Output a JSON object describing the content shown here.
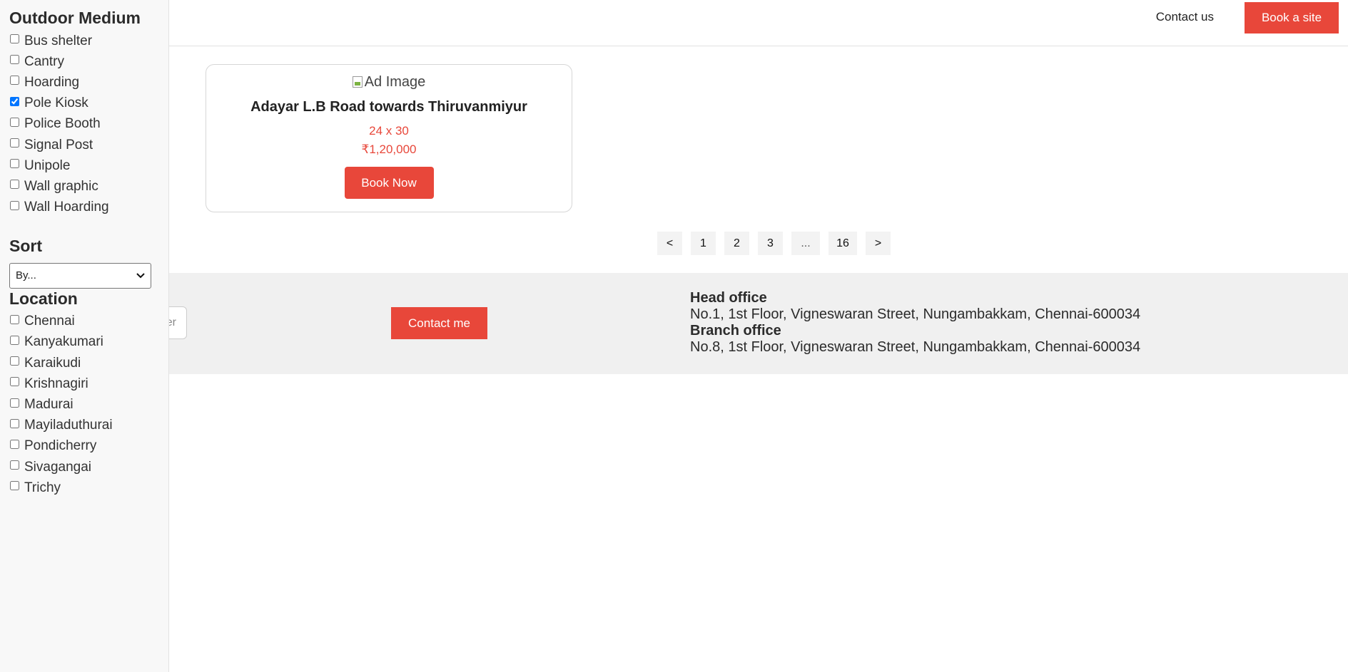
{
  "sidebar": {
    "outdoor_heading": "Outdoor Medium",
    "outdoor_items": [
      {
        "label": "Bus shelter",
        "checked": false
      },
      {
        "label": "Cantry",
        "checked": false
      },
      {
        "label": "Hoarding",
        "checked": false
      },
      {
        "label": "Pole Kiosk",
        "checked": true
      },
      {
        "label": "Police Booth",
        "checked": false
      },
      {
        "label": "Signal Post",
        "checked": false
      },
      {
        "label": "Unipole",
        "checked": false
      },
      {
        "label": "Wall graphic",
        "checked": false
      },
      {
        "label": "Wall Hoarding",
        "checked": false
      }
    ],
    "sort_heading": "Sort",
    "sort_value": "By...",
    "location_heading": "Location",
    "location_items": [
      {
        "label": "Chennai",
        "checked": false
      },
      {
        "label": "Kanyakumari",
        "checked": false
      },
      {
        "label": "Karaikudi",
        "checked": false
      },
      {
        "label": "Krishnagiri",
        "checked": false
      },
      {
        "label": "Madurai",
        "checked": false
      },
      {
        "label": "Mayiladuthurai",
        "checked": false
      },
      {
        "label": "Pondicherry",
        "checked": false
      },
      {
        "label": "Sivagangai",
        "checked": false
      },
      {
        "label": "Trichy",
        "checked": false
      }
    ]
  },
  "header": {
    "contact_label": "Contact us",
    "book_site_label": "Book a site"
  },
  "card": {
    "image_alt": "Ad Image",
    "title": "Adayar L.B Road towards Thiruvanmiyur",
    "size": "24 x 30",
    "price": "₹1,20,000",
    "book_label": "Book Now"
  },
  "pagination": {
    "prev": "<",
    "pages": [
      "1",
      "2",
      "3"
    ],
    "ellipsis": "...",
    "last": "16",
    "next": ">"
  },
  "footer": {
    "search_stub_text": "er",
    "contact_me_label": "Contact me",
    "head_office_label": "Head office",
    "head_office_address": "No.1, 1st Floor, Vigneswaran Street, Nungambakkam, Chennai-600034",
    "branch_office_label": "Branch office",
    "branch_office_address": "No.8, 1st Floor, Vigneswaran Street, Nungambakkam, Chennai-600034"
  },
  "colors": {
    "accent": "#e8473a",
    "sidebar_bg": "#f8f8f8",
    "footer_bg": "#f0f0f0"
  }
}
